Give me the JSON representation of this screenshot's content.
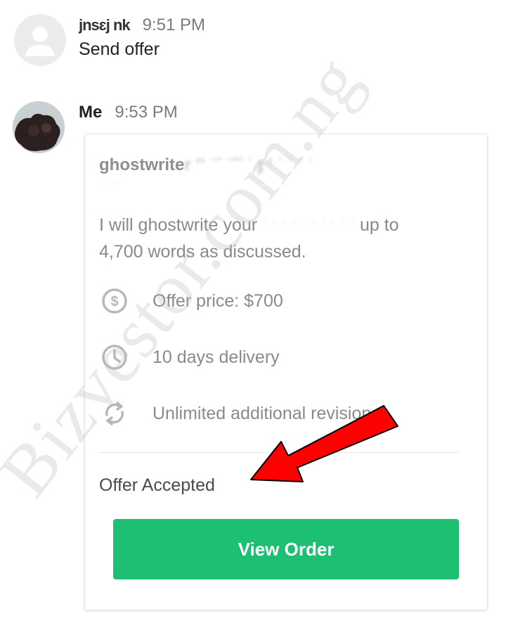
{
  "messages": [
    {
      "sender": "jnsɛj nk",
      "time": "9:51 PM",
      "text": "Send offer"
    },
    {
      "sender": "Me",
      "time": "9:53 PM"
    }
  ],
  "offer": {
    "gig_title": "ghostwrite",
    "gig_title_redacted": "r ʼʼ ˈ˝ ˈ˝˝ ˈ ɟ ʼ ˈ ˈ ˈ ˈ",
    "description_start": "I will ghostwrite your",
    "description_redacted": "ˑ ˑ ˑ ˑ ˑ ˑ ˑ ˑ ˑ ˑ",
    "description_end": "up to",
    "description_line2": "4,700 words as discussed.",
    "details": [
      {
        "icon": "dollar-circle-icon",
        "label": "Offer price: $700"
      },
      {
        "icon": "clock-icon",
        "label": "10 days delivery"
      },
      {
        "icon": "revisions-icon",
        "label": "Unlimited additional revisions"
      }
    ],
    "status": "Offer Accepted",
    "button_label": "View Order"
  },
  "watermark": "Bizvestor.com.ng",
  "colors": {
    "button": "#1dbf73",
    "arrow": "#ff0000",
    "muted_text": "#8a8a8a",
    "time_text": "#7b7b7b"
  }
}
